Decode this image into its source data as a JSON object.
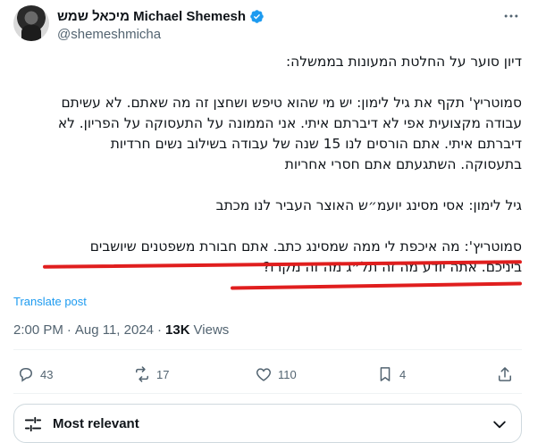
{
  "author": {
    "display_name": "מיכאל שמש Michael Shemesh",
    "handle": "@shemeshmicha"
  },
  "tweet": {
    "lines": [
      "דיון סוער על החלטת המעונות בממשלה:",
      "",
      "סמוטריץ' תקף את גיל לימון: יש מי שהוא טיפש ושחצן זה מה שאתם. לא עשיתם",
      "עבודה מקצועית אפי לא דיברתם איתי. אני הממונה על התעסוקה על הפריון. לא",
      "דיברתם איתי. אתם הורסים לנו 15 שנה של עבודה בשילוב נשים חרדיות",
      "בתעסוקה. השתגעתם אתם חסרי אחריות",
      "",
      "גיל לימון: אסי מסינג יועמ״ש האוצר העביר לנו מכתב",
      "",
      "סמוטריץ': מה איכפת לי ממה שמסינג כתב. אתם חבורת משפטנים שיושבים",
      "ביניכם. אתה יודע מה זה תל״ג מה זה מקרו?"
    ],
    "translate_label": "Translate post",
    "time": "2:00 PM",
    "separator": "·",
    "date": "Aug 11, 2024",
    "views_count": "13K",
    "views_label": "Views"
  },
  "actions": {
    "replies": "43",
    "reposts": "17",
    "likes": "110",
    "bookmarks": "4"
  },
  "replies_sort": {
    "label": "Most relevant"
  },
  "colors": {
    "accent": "#1d9bf0",
    "secondary_text": "#536471",
    "highlight_underline": "#e01e1e"
  }
}
